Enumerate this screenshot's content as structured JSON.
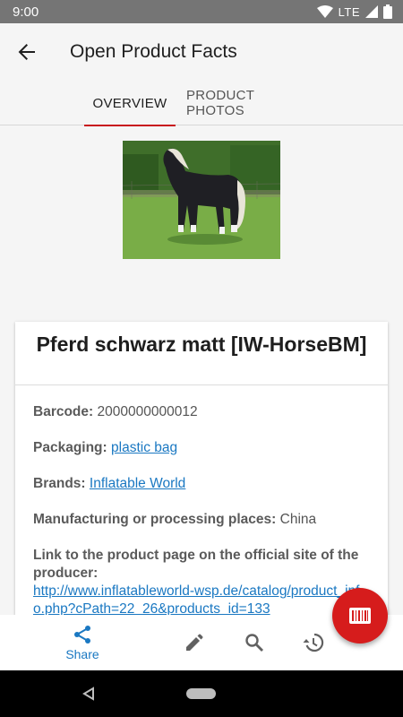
{
  "status_bar": {
    "time": "9:00",
    "network": "LTE"
  },
  "app_bar": {
    "title": "Open Product Facts",
    "back_icon": "arrow-back-icon"
  },
  "tabs": [
    {
      "label": "OVERVIEW",
      "active": true
    },
    {
      "label": "PRODUCT PHOTOS",
      "active": false
    }
  ],
  "product": {
    "image_description": "product-photo",
    "name": "Pferd schwarz matt [IW-HorseBM]",
    "facts": {
      "barcode_label": "Barcode:",
      "barcode_value": "2000000000012",
      "packaging_label": "Packaging:",
      "packaging_value": "plastic bag",
      "brands_label": "Brands:",
      "brands_value": "Inflatable World",
      "manufacturing_label": "Manufacturing or processing places:",
      "manufacturing_value": "China",
      "link_label": "Link to the product page on the official site of the producer:",
      "link_value": "http://www.inflatableworld-wsp.de/catalog/product_info.php?cPath=22_26&products_id=133"
    }
  },
  "bottom_nav": {
    "share_label": "Share",
    "icons": [
      "share-icon",
      "edit-icon",
      "search-icon",
      "history-icon"
    ]
  },
  "fab": {
    "icon": "barcode-icon"
  },
  "colors": {
    "accent": "#c8161d",
    "fab": "#d61c1c",
    "link": "#1a78c2",
    "status_bar": "#757575"
  }
}
